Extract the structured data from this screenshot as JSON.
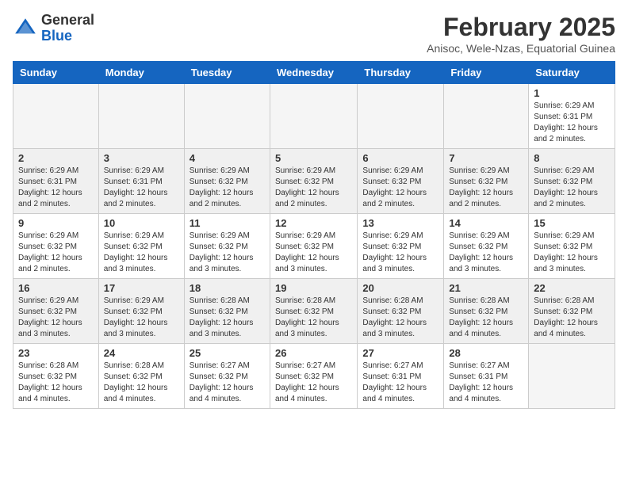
{
  "header": {
    "logo_general": "General",
    "logo_blue": "Blue",
    "title": "February 2025",
    "subtitle": "Anisoc, Wele-Nzas, Equatorial Guinea"
  },
  "days_of_week": [
    "Sunday",
    "Monday",
    "Tuesday",
    "Wednesday",
    "Thursday",
    "Friday",
    "Saturday"
  ],
  "weeks": [
    {
      "shaded": false,
      "days": [
        {
          "num": "",
          "info": "",
          "empty": true
        },
        {
          "num": "",
          "info": "",
          "empty": true
        },
        {
          "num": "",
          "info": "",
          "empty": true
        },
        {
          "num": "",
          "info": "",
          "empty": true
        },
        {
          "num": "",
          "info": "",
          "empty": true
        },
        {
          "num": "",
          "info": "",
          "empty": true
        },
        {
          "num": "1",
          "info": "Sunrise: 6:29 AM\nSunset: 6:31 PM\nDaylight: 12 hours\nand 2 minutes.",
          "empty": false
        }
      ]
    },
    {
      "shaded": true,
      "days": [
        {
          "num": "2",
          "info": "Sunrise: 6:29 AM\nSunset: 6:31 PM\nDaylight: 12 hours\nand 2 minutes.",
          "empty": false
        },
        {
          "num": "3",
          "info": "Sunrise: 6:29 AM\nSunset: 6:31 PM\nDaylight: 12 hours\nand 2 minutes.",
          "empty": false
        },
        {
          "num": "4",
          "info": "Sunrise: 6:29 AM\nSunset: 6:32 PM\nDaylight: 12 hours\nand 2 minutes.",
          "empty": false
        },
        {
          "num": "5",
          "info": "Sunrise: 6:29 AM\nSunset: 6:32 PM\nDaylight: 12 hours\nand 2 minutes.",
          "empty": false
        },
        {
          "num": "6",
          "info": "Sunrise: 6:29 AM\nSunset: 6:32 PM\nDaylight: 12 hours\nand 2 minutes.",
          "empty": false
        },
        {
          "num": "7",
          "info": "Sunrise: 6:29 AM\nSunset: 6:32 PM\nDaylight: 12 hours\nand 2 minutes.",
          "empty": false
        },
        {
          "num": "8",
          "info": "Sunrise: 6:29 AM\nSunset: 6:32 PM\nDaylight: 12 hours\nand 2 minutes.",
          "empty": false
        }
      ]
    },
    {
      "shaded": false,
      "days": [
        {
          "num": "9",
          "info": "Sunrise: 6:29 AM\nSunset: 6:32 PM\nDaylight: 12 hours\nand 2 minutes.",
          "empty": false
        },
        {
          "num": "10",
          "info": "Sunrise: 6:29 AM\nSunset: 6:32 PM\nDaylight: 12 hours\nand 3 minutes.",
          "empty": false
        },
        {
          "num": "11",
          "info": "Sunrise: 6:29 AM\nSunset: 6:32 PM\nDaylight: 12 hours\nand 3 minutes.",
          "empty": false
        },
        {
          "num": "12",
          "info": "Sunrise: 6:29 AM\nSunset: 6:32 PM\nDaylight: 12 hours\nand 3 minutes.",
          "empty": false
        },
        {
          "num": "13",
          "info": "Sunrise: 6:29 AM\nSunset: 6:32 PM\nDaylight: 12 hours\nand 3 minutes.",
          "empty": false
        },
        {
          "num": "14",
          "info": "Sunrise: 6:29 AM\nSunset: 6:32 PM\nDaylight: 12 hours\nand 3 minutes.",
          "empty": false
        },
        {
          "num": "15",
          "info": "Sunrise: 6:29 AM\nSunset: 6:32 PM\nDaylight: 12 hours\nand 3 minutes.",
          "empty": false
        }
      ]
    },
    {
      "shaded": true,
      "days": [
        {
          "num": "16",
          "info": "Sunrise: 6:29 AM\nSunset: 6:32 PM\nDaylight: 12 hours\nand 3 minutes.",
          "empty": false
        },
        {
          "num": "17",
          "info": "Sunrise: 6:29 AM\nSunset: 6:32 PM\nDaylight: 12 hours\nand 3 minutes.",
          "empty": false
        },
        {
          "num": "18",
          "info": "Sunrise: 6:28 AM\nSunset: 6:32 PM\nDaylight: 12 hours\nand 3 minutes.",
          "empty": false
        },
        {
          "num": "19",
          "info": "Sunrise: 6:28 AM\nSunset: 6:32 PM\nDaylight: 12 hours\nand 3 minutes.",
          "empty": false
        },
        {
          "num": "20",
          "info": "Sunrise: 6:28 AM\nSunset: 6:32 PM\nDaylight: 12 hours\nand 3 minutes.",
          "empty": false
        },
        {
          "num": "21",
          "info": "Sunrise: 6:28 AM\nSunset: 6:32 PM\nDaylight: 12 hours\nand 4 minutes.",
          "empty": false
        },
        {
          "num": "22",
          "info": "Sunrise: 6:28 AM\nSunset: 6:32 PM\nDaylight: 12 hours\nand 4 minutes.",
          "empty": false
        }
      ]
    },
    {
      "shaded": false,
      "days": [
        {
          "num": "23",
          "info": "Sunrise: 6:28 AM\nSunset: 6:32 PM\nDaylight: 12 hours\nand 4 minutes.",
          "empty": false
        },
        {
          "num": "24",
          "info": "Sunrise: 6:28 AM\nSunset: 6:32 PM\nDaylight: 12 hours\nand 4 minutes.",
          "empty": false
        },
        {
          "num": "25",
          "info": "Sunrise: 6:27 AM\nSunset: 6:32 PM\nDaylight: 12 hours\nand 4 minutes.",
          "empty": false
        },
        {
          "num": "26",
          "info": "Sunrise: 6:27 AM\nSunset: 6:32 PM\nDaylight: 12 hours\nand 4 minutes.",
          "empty": false
        },
        {
          "num": "27",
          "info": "Sunrise: 6:27 AM\nSunset: 6:31 PM\nDaylight: 12 hours\nand 4 minutes.",
          "empty": false
        },
        {
          "num": "28",
          "info": "Sunrise: 6:27 AM\nSunset: 6:31 PM\nDaylight: 12 hours\nand 4 minutes.",
          "empty": false
        },
        {
          "num": "",
          "info": "",
          "empty": true
        }
      ]
    }
  ]
}
